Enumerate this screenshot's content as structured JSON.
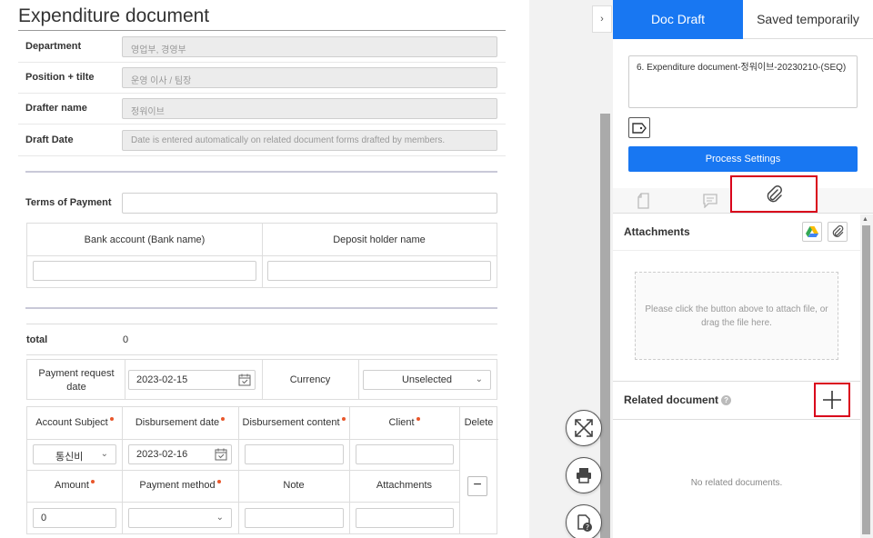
{
  "document": {
    "title": "Expenditure document",
    "fields": [
      {
        "label": "Department",
        "value": "영업부, 경영부"
      },
      {
        "label": "Position + tilte",
        "value": "운영 이사 / 팀장"
      },
      {
        "label": "Drafter name",
        "value": "정워이브"
      },
      {
        "label": "Draft Date",
        "value": "Date is entered automatically on related document forms drafted by members."
      }
    ],
    "terms_of_payment": {
      "label": "Terms of Payment",
      "value": ""
    },
    "bank_table": {
      "col1": "Bank account (Bank name)",
      "col2": "Deposit holder name"
    },
    "total": {
      "label": "total",
      "value": "0"
    },
    "payment_row": {
      "request_label": "Payment request date",
      "request_date": "2023-02-15",
      "currency_label": "Currency",
      "currency_value": "Unselected"
    },
    "account_table": {
      "headers": [
        "Account Subject",
        "Disbursement date",
        "Disbursement content",
        "Client",
        "Delete"
      ],
      "subheaders": [
        "Amount",
        "Payment method",
        "Note",
        "Attachments"
      ],
      "row": {
        "account_subject": "통신비",
        "disbursement_date": "2023-02-16",
        "amount": "0"
      },
      "delete_label": "−"
    }
  },
  "sidebar_toggle": "›",
  "panel": {
    "tabs": {
      "draft": "Doc Draft",
      "saved": "Saved temporarily"
    },
    "doc_name": "6. Expenditure document-정워이브-20230210-(SEQ)",
    "process_settings": "Process Settings",
    "attachments_title": "Attachments",
    "drop_hint": "Please click the button above to attach file, or drag the file here.",
    "related_title": "Related document",
    "help_mark": "?",
    "no_related": "No related documents.",
    "add_symbol": "+"
  },
  "colors": {
    "accent": "#1877f2",
    "highlight": "#d9001b",
    "required": "#e8572b"
  },
  "icons": [
    "expand-icon",
    "print-icon",
    "doc-help-icon",
    "tag-icon",
    "approval-doc-icon",
    "comment-icon",
    "paperclip-icon",
    "google-drive-icon",
    "calendar-icon",
    "chevron-down-icon"
  ]
}
